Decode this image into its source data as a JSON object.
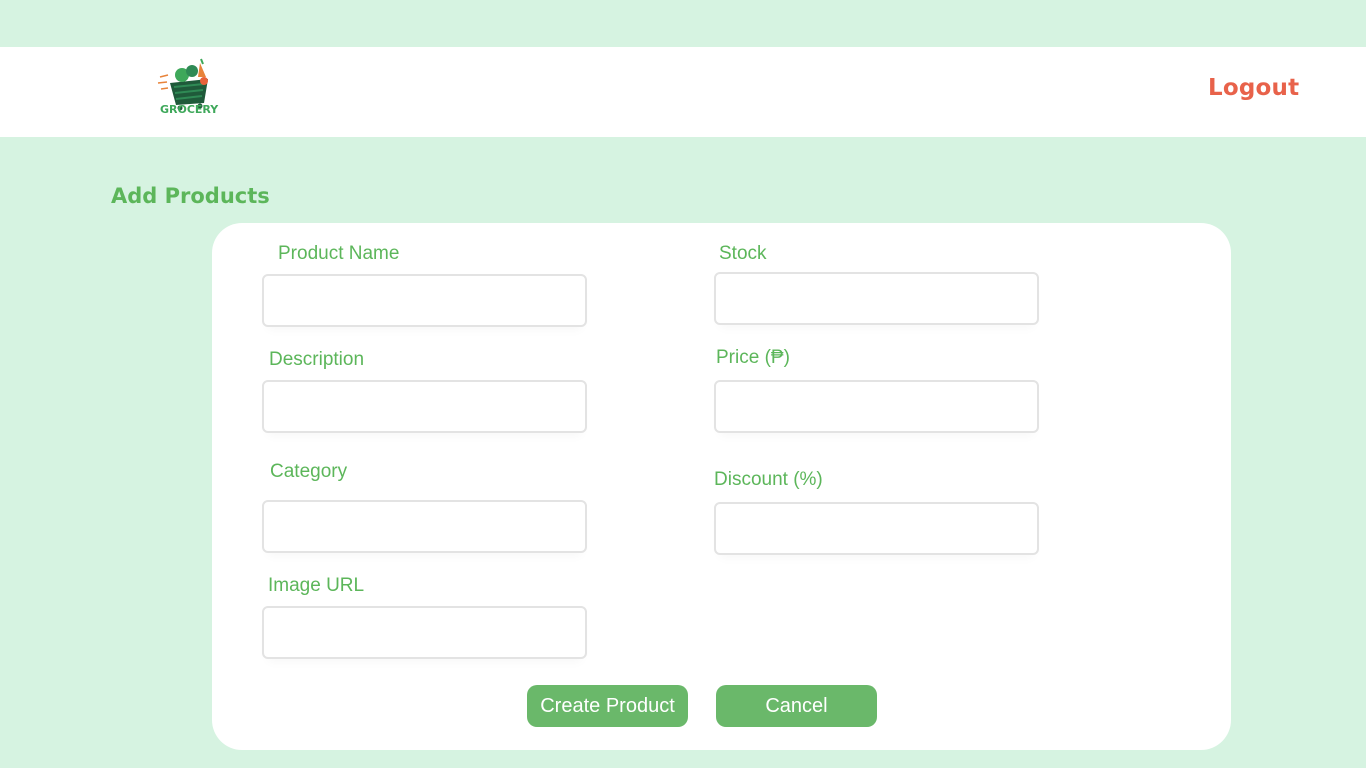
{
  "header": {
    "logo_text": "GROCERY",
    "logout_label": "Logout"
  },
  "page": {
    "title": "Add Products"
  },
  "form": {
    "product_name_label": "Product Name",
    "stock_label": "Stock",
    "description_label": "Description",
    "price_label": "Price (₱)",
    "category_label": "Category",
    "discount_label": "Discount (%)",
    "image_url_label": "Image URL",
    "product_name_value": "",
    "stock_value": "",
    "description_value": "",
    "price_value": "",
    "category_value": "",
    "discount_value": "",
    "image_url_value": ""
  },
  "actions": {
    "create_label": "Create Product",
    "cancel_label": "Cancel"
  },
  "colors": {
    "background": "#d6f3e1",
    "accent_green": "#5cb65a",
    "button_green": "#6ab86a",
    "logout_red": "#e8624a"
  },
  "icons": {
    "logo": "grocery-basket-logo"
  }
}
